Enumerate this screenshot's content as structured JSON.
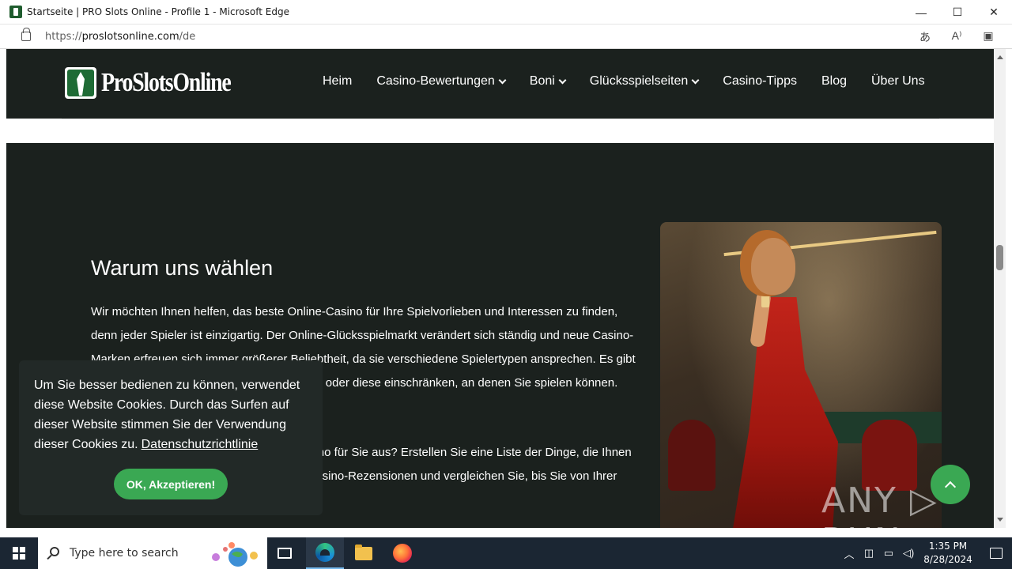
{
  "window": {
    "title": "Startseite | PRO Slots Online - Profile 1 - Microsoft Edge",
    "controls": {
      "minimize": "—",
      "maximize": "☐",
      "close": "✕"
    }
  },
  "address": {
    "url_prefix": "https://",
    "url_host": "proslotsonline.com",
    "url_path": "/de",
    "icons": [
      "translate-icon",
      "read-aloud-icon",
      "split-screen-icon"
    ]
  },
  "site": {
    "logo_text": "ProSlotsOnline",
    "nav": [
      {
        "label": "Heim",
        "dropdown": false
      },
      {
        "label": "Casino-Bewertungen",
        "dropdown": true
      },
      {
        "label": "Boni",
        "dropdown": true
      },
      {
        "label": "Glücksspielseiten",
        "dropdown": true
      },
      {
        "label": "Casino-Tipps",
        "dropdown": false
      },
      {
        "label": "Blog",
        "dropdown": false
      },
      {
        "label": "Über Uns",
        "dropdown": false
      }
    ]
  },
  "section": {
    "heading": "Warum uns wählen",
    "para1": "Wir möchten Ihnen helfen, das beste Online-Casino für Ihre Spielvorlieben und Interessen zu finden, denn jeder Spieler ist einzigartig. Der Online-Glücksspielmarkt verändert sich ständig und neue Casino-Marken erfreuen sich immer größerer Beliebtheit, da sie verschiedene Spielertypen ansprechen. Es gibt Vorschriften, die sich auf die Orte auswirken oder diese einschränken, an denen Sie spielen können.",
    "para2": "Wie wählen Sie also das beste Online-Casino für Sie aus? Erstellen Sie eine Liste der Dinge, die Ihnen wichtig sind, lesen Sie die besten Online-Casino-Rezensionen und vergleichen Sie, bis Sie von Ihrer Entscheidung überzeugt sind."
  },
  "cookie": {
    "text": "Um Sie besser bedienen zu können, verwendet diese Website Cookies. Durch das Surfen auf dieser Website stimmen Sie der Verwendung dieser Cookies zu.",
    "link": "Datenschutzrichtlinie",
    "button": "OK, Akzeptieren!"
  },
  "watermark": "ANY ▷ RUN",
  "colors": {
    "page_bg": "#1b211e",
    "accent_green": "#3aa853",
    "cookie_bg": "#222927",
    "taskbar": "#1b2633"
  },
  "taskbar": {
    "search_placeholder": "Type here to search",
    "time": "1:35 PM",
    "date": "8/28/2024",
    "tray_icons": [
      "chevron-up-icon",
      "meet-now-icon",
      "network-icon",
      "volume-icon"
    ]
  }
}
